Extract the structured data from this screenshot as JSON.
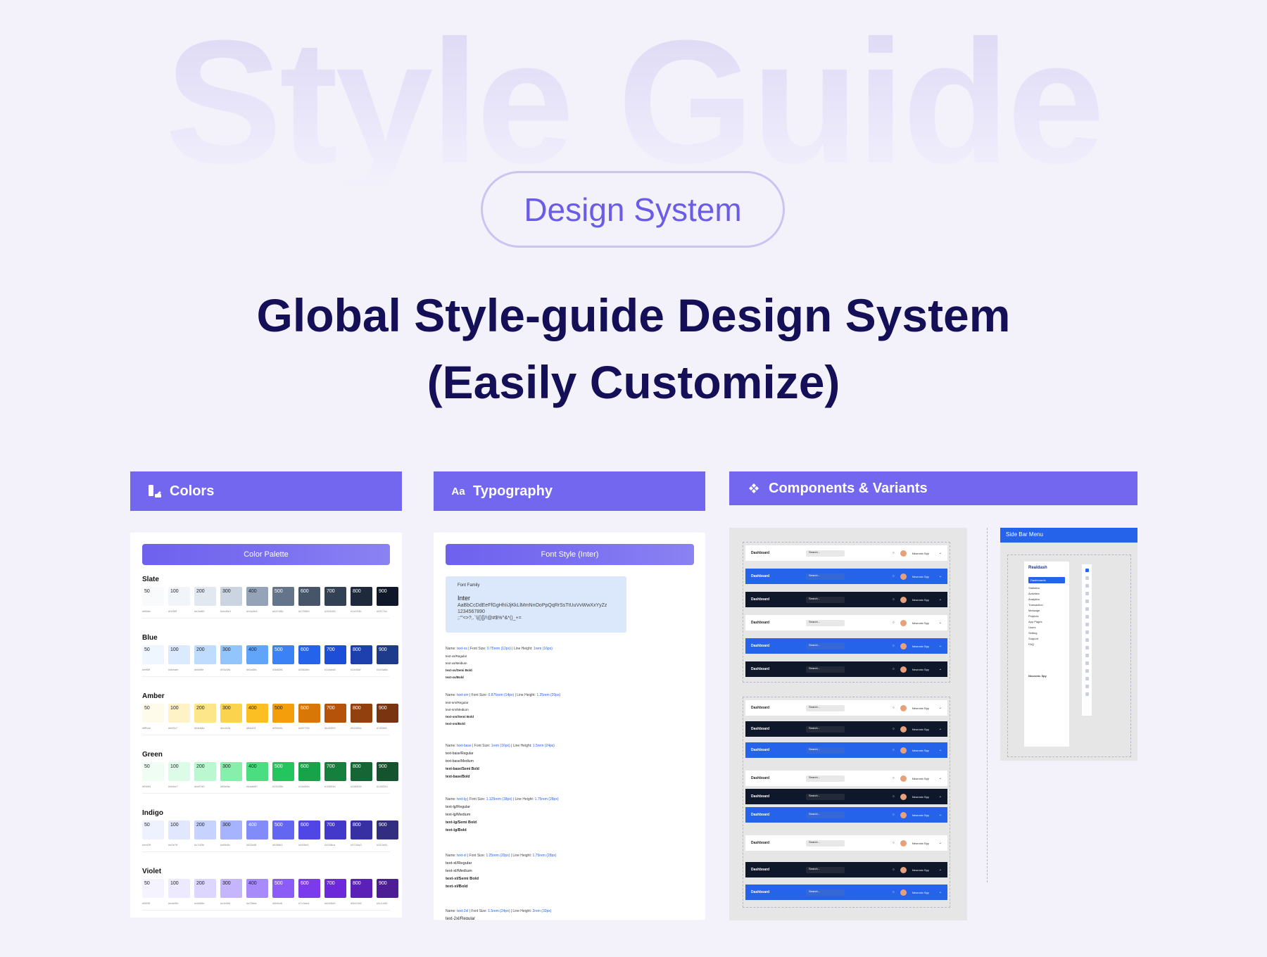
{
  "hero": {
    "background_text": "Style Guide",
    "pill": "Design System",
    "headline_line1": "Global Style-guide Design System",
    "headline_line2": "(Easily Customize)"
  },
  "sections": {
    "colors": {
      "label": "Colors",
      "icon": "palette-icon"
    },
    "typography": {
      "label": "Typography",
      "icon": "text-aa-icon",
      "icon_text": "Aa"
    },
    "components": {
      "label": "Components & Variants",
      "icon": "components-diamond-icon"
    }
  },
  "colors_panel": {
    "title": "Color Palette",
    "steps": [
      "50",
      "100",
      "200",
      "300",
      "400",
      "500",
      "600",
      "700",
      "800",
      "900"
    ],
    "groups": [
      {
        "name": "Slate",
        "swatches": [
          "#f8fafc",
          "#f1f5f9",
          "#e2e8f0",
          "#cbd5e1",
          "#94a3b8",
          "#64748b",
          "#475569",
          "#334155",
          "#1e293b",
          "#0f172a"
        ]
      },
      {
        "name": "Blue",
        "swatches": [
          "#eff6ff",
          "#dbeafe",
          "#bfdbfe",
          "#93c5fd",
          "#60a5fa",
          "#3b82f6",
          "#2563eb",
          "#1d4ed8",
          "#1e40af",
          "#1e3a8a"
        ]
      },
      {
        "name": "Amber",
        "swatches": [
          "#fffbeb",
          "#fef3c7",
          "#fde68a",
          "#fcd34d",
          "#fbbf24",
          "#f59e0b",
          "#d97706",
          "#b45309",
          "#92400e",
          "#78350f"
        ]
      },
      {
        "name": "Green",
        "swatches": [
          "#f0fdf4",
          "#dcfce7",
          "#bbf7d0",
          "#86efac",
          "#4ade80",
          "#22c55e",
          "#16a34a",
          "#15803d",
          "#166534",
          "#14532d"
        ]
      },
      {
        "name": "Indigo",
        "swatches": [
          "#eef2ff",
          "#e0e7ff",
          "#c7d2fe",
          "#a5b4fc",
          "#818cf8",
          "#6366f1",
          "#4f46e5",
          "#4338ca",
          "#3730a3",
          "#312e81"
        ]
      },
      {
        "name": "Violet",
        "swatches": [
          "#f5f3ff",
          "#ede9fe",
          "#ddd6fe",
          "#c4b5fd",
          "#a78bfa",
          "#8b5cf6",
          "#7c3aed",
          "#6d28d9",
          "#5b21b6",
          "#4c1d95"
        ]
      }
    ]
  },
  "typography_panel": {
    "title": "Font Style (Inter)",
    "font_family_label": "Font Family",
    "font_name": "Inter",
    "alphabet": "AaBbCcDdEeFfGgHhIiJjKkLlMmNnOoPpQqRrSsTtUuVvWwXxYyZz",
    "digits": "1234567890",
    "symbols": ";:'\"<>?,.`\\|{}[]/!@#$%^&*()_+=",
    "styles": [
      {
        "name": "text-xs",
        "size": "0.75rem (12px)",
        "line": "1rem (16px)",
        "samples": [
          "text-xs/Regular",
          "text-xs/Medium",
          "text-xs/Semi Bold",
          "text-xs/Bold"
        ]
      },
      {
        "name": "text-sm",
        "size": "0.875rem (14px)",
        "line": "1.25rem (20px)",
        "samples": [
          "text-sm/Regular",
          "text-sm/Medium",
          "text-sm/Semi Bold",
          "text-sm/Bold"
        ]
      },
      {
        "name": "text-base",
        "size": "1rem (16px)",
        "line": "1.5rem (24px)",
        "samples": [
          "text-base/Regular",
          "text-base/Medium",
          "text-base/Semi Bold",
          "text-base/Bold"
        ]
      },
      {
        "name": "text-lg",
        "size": "1.125rem (18px)",
        "line": "1.75rem (28px)",
        "samples": [
          "text-lg/Regular",
          "text-lg/Medium",
          "text-lg/Semi Bold",
          "text-lg/Bold"
        ]
      },
      {
        "name": "text-xl",
        "size": "1.25rem (20px)",
        "line": "1.75rem (28px)",
        "samples": [
          "text-xl/Regular",
          "text-xl/Medium",
          "text-xl/Semi Bold",
          "text-xl/Bold"
        ]
      },
      {
        "name": "text-2xl",
        "size": "1.5rem (24px)",
        "line": "2rem (32px)",
        "samples": [
          "text-2xl/Regular"
        ]
      }
    ]
  },
  "components_panel": {
    "header_title": "Dashboard",
    "search_placeholder": "Search...",
    "user_name": "Neuronic Spy",
    "header_variants_group1": [
      "white",
      "blue",
      "navy",
      "white",
      "blue",
      "navy"
    ],
    "header_variants_group2": [
      "white",
      "navy",
      "blue",
      "white",
      "navy",
      "blue",
      "white",
      "navy",
      "blue"
    ]
  },
  "sidebar_panel": {
    "title": "Side Bar Menu",
    "brand": "Realdash",
    "active_item": "Dashboards",
    "items": [
      "Statistics",
      "Activities",
      "Analytics",
      "Transaction",
      "Message",
      "Projects",
      "App Pages",
      "Users",
      "Setting",
      "Support",
      "FAQ"
    ],
    "user_name": "Neuronic Spy"
  }
}
